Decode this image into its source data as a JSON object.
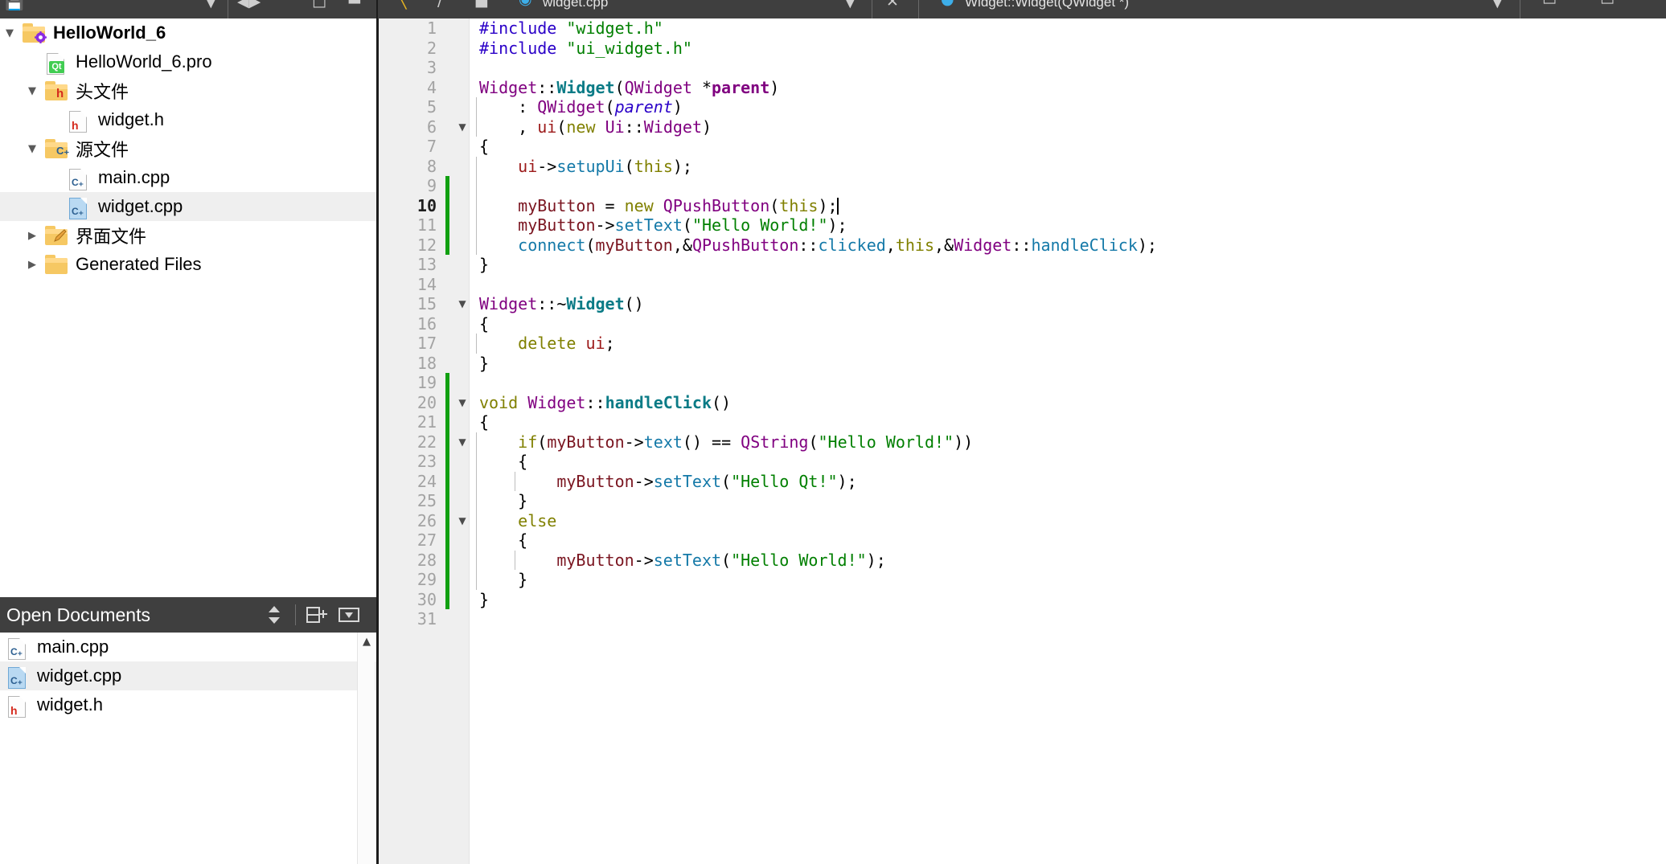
{
  "toolbar": {
    "left_glyphs": [
      "save-all-icon",
      "chevron-down-icon",
      "nav-back-forward-icon",
      "history-icon",
      "split-icon",
      "minimize-icon"
    ],
    "open_file_label": "widget.cpp",
    "symbol_label": "Widget::Widget(QWidget *)",
    "right_glyphs": [
      "chevron-down-icon",
      "close-icon",
      "location-marker-icon",
      "chevron-down-icon",
      "split-icon",
      "close-icon"
    ]
  },
  "sidebar": {
    "project_tree": [
      {
        "label": "HelloWorld_6",
        "indent": 0,
        "arrow": "open",
        "icon": "folder-project-icon",
        "bold": true,
        "selected": false
      },
      {
        "label": "HelloWorld_6.pro",
        "indent": 1,
        "arrow": "none",
        "icon": "file-qt-icon",
        "bold": false,
        "selected": false
      },
      {
        "label": "头文件",
        "indent": 1,
        "arrow": "open",
        "icon": "folder-headers-icon",
        "bold": false,
        "selected": false
      },
      {
        "label": "widget.h",
        "indent": 2,
        "arrow": "none",
        "icon": "file-h-icon",
        "bold": false,
        "selected": false
      },
      {
        "label": "源文件",
        "indent": 1,
        "arrow": "open",
        "icon": "folder-sources-icon",
        "bold": false,
        "selected": false
      },
      {
        "label": "main.cpp",
        "indent": 2,
        "arrow": "none",
        "icon": "file-cpp-icon",
        "bold": false,
        "selected": false
      },
      {
        "label": "widget.cpp",
        "indent": 2,
        "arrow": "none",
        "icon": "file-cpp-blue-icon",
        "bold": false,
        "selected": true
      },
      {
        "label": "界面文件",
        "indent": 1,
        "arrow": "closed",
        "icon": "folder-forms-icon",
        "bold": false,
        "selected": false
      },
      {
        "label": "Generated Files",
        "indent": 1,
        "arrow": "closed",
        "icon": "folder-plain-icon",
        "bold": false,
        "selected": false
      }
    ],
    "open_documents": {
      "title": "Open Documents",
      "actions": [
        "sort-toggle-icon",
        "split-add-icon",
        "dropdown-menu-icon"
      ],
      "items": [
        {
          "label": "main.cpp",
          "icon": "file-cpp-icon",
          "selected": false
        },
        {
          "label": "widget.cpp",
          "icon": "file-cpp-blue-icon",
          "selected": true
        },
        {
          "label": "widget.h",
          "icon": "file-h-icon",
          "selected": false
        }
      ]
    }
  },
  "editor": {
    "filename": "widget.cpp",
    "cursor_line": 10,
    "total_lines": 31,
    "lines": [
      {
        "n": 1,
        "fold": "",
        "changed": false,
        "indent_guides": [],
        "tokens": [
          {
            "t": "#include ",
            "c": "t-pre"
          },
          {
            "t": "\"widget.h\"",
            "c": "t-str"
          }
        ]
      },
      {
        "n": 2,
        "fold": "",
        "changed": false,
        "indent_guides": [],
        "tokens": [
          {
            "t": "#include ",
            "c": "t-pre"
          },
          {
            "t": "\"ui_widget.h\"",
            "c": "t-str"
          }
        ]
      },
      {
        "n": 3,
        "fold": "",
        "changed": false,
        "indent_guides": [],
        "tokens": []
      },
      {
        "n": 4,
        "fold": "",
        "changed": false,
        "indent_guides": [],
        "tokens": [
          {
            "t": "Widget",
            "c": "t-type"
          },
          {
            "t": "::",
            "c": "t-plain"
          },
          {
            "t": "Widget",
            "c": "t-fn"
          },
          {
            "t": "(",
            "c": "t-plain"
          },
          {
            "t": "QWidget ",
            "c": "t-type"
          },
          {
            "t": "*",
            "c": "t-plain"
          },
          {
            "t": "parent",
            "c": "t-type t-bold"
          },
          {
            "t": ")",
            "c": "t-plain"
          }
        ]
      },
      {
        "n": 5,
        "fold": "",
        "changed": false,
        "indent_guides": [
          0
        ],
        "tokens": [
          {
            "t": "    : ",
            "c": "t-plain"
          },
          {
            "t": "QWidget",
            "c": "t-type"
          },
          {
            "t": "(",
            "c": "t-plain"
          },
          {
            "t": "parent",
            "c": "t-param"
          },
          {
            "t": ")",
            "c": "t-plain"
          }
        ]
      },
      {
        "n": 6,
        "fold": "down",
        "changed": false,
        "indent_guides": [
          0
        ],
        "tokens": [
          {
            "t": "    , ",
            "c": "t-plain"
          },
          {
            "t": "ui",
            "c": "t-field"
          },
          {
            "t": "(",
            "c": "t-plain"
          },
          {
            "t": "new ",
            "c": "t-kw"
          },
          {
            "t": "Ui",
            "c": "t-type"
          },
          {
            "t": "::",
            "c": "t-plain"
          },
          {
            "t": "Widget",
            "c": "t-type"
          },
          {
            "t": ")",
            "c": "t-plain"
          }
        ]
      },
      {
        "n": 7,
        "fold": "",
        "changed": false,
        "indent_guides": [],
        "tokens": [
          {
            "t": "{",
            "c": "t-plain"
          }
        ]
      },
      {
        "n": 8,
        "fold": "",
        "changed": false,
        "indent_guides": [
          0
        ],
        "tokens": [
          {
            "t": "    ",
            "c": "t-plain"
          },
          {
            "t": "ui",
            "c": "t-field"
          },
          {
            "t": "->",
            "c": "t-plain"
          },
          {
            "t": "setupUi",
            "c": "t-call"
          },
          {
            "t": "(",
            "c": "t-plain"
          },
          {
            "t": "this",
            "c": "t-kw"
          },
          {
            "t": ");",
            "c": "t-plain"
          }
        ]
      },
      {
        "n": 9,
        "fold": "",
        "changed": true,
        "indent_guides": [
          0
        ],
        "tokens": []
      },
      {
        "n": 10,
        "fold": "",
        "changed": true,
        "indent_guides": [
          0
        ],
        "caret": true,
        "tokens": [
          {
            "t": "    ",
            "c": "t-plain"
          },
          {
            "t": "myButton",
            "c": "t-var"
          },
          {
            "t": " = ",
            "c": "t-plain"
          },
          {
            "t": "new ",
            "c": "t-kw"
          },
          {
            "t": "QPushButton",
            "c": "t-type"
          },
          {
            "t": "(",
            "c": "t-plain"
          },
          {
            "t": "this",
            "c": "t-kw"
          },
          {
            "t": ");",
            "c": "t-plain"
          }
        ]
      },
      {
        "n": 11,
        "fold": "",
        "changed": true,
        "indent_guides": [
          0
        ],
        "tokens": [
          {
            "t": "    ",
            "c": "t-plain"
          },
          {
            "t": "myButton",
            "c": "t-var"
          },
          {
            "t": "->",
            "c": "t-plain"
          },
          {
            "t": "setText",
            "c": "t-call"
          },
          {
            "t": "(",
            "c": "t-plain"
          },
          {
            "t": "\"Hello World!\"",
            "c": "t-str"
          },
          {
            "t": ");",
            "c": "t-plain"
          }
        ]
      },
      {
        "n": 12,
        "fold": "",
        "changed": true,
        "indent_guides": [
          0
        ],
        "tokens": [
          {
            "t": "    ",
            "c": "t-plain"
          },
          {
            "t": "connect",
            "c": "t-call"
          },
          {
            "t": "(",
            "c": "t-plain"
          },
          {
            "t": "myButton",
            "c": "t-var"
          },
          {
            "t": ",&",
            "c": "t-plain"
          },
          {
            "t": "QPushButton",
            "c": "t-type"
          },
          {
            "t": "::",
            "c": "t-plain"
          },
          {
            "t": "clicked",
            "c": "t-call"
          },
          {
            "t": ",",
            "c": "t-plain"
          },
          {
            "t": "this",
            "c": "t-kw"
          },
          {
            "t": ",&",
            "c": "t-plain"
          },
          {
            "t": "Widget",
            "c": "t-type"
          },
          {
            "t": "::",
            "c": "t-plain"
          },
          {
            "t": "handleClick",
            "c": "t-call"
          },
          {
            "t": ");",
            "c": "t-plain"
          }
        ]
      },
      {
        "n": 13,
        "fold": "",
        "changed": false,
        "indent_guides": [],
        "tokens": [
          {
            "t": "}",
            "c": "t-plain"
          }
        ]
      },
      {
        "n": 14,
        "fold": "",
        "changed": false,
        "indent_guides": [],
        "tokens": []
      },
      {
        "n": 15,
        "fold": "down",
        "changed": false,
        "indent_guides": [],
        "tokens": [
          {
            "t": "Widget",
            "c": "t-type"
          },
          {
            "t": "::~",
            "c": "t-plain"
          },
          {
            "t": "Widget",
            "c": "t-fn"
          },
          {
            "t": "()",
            "c": "t-plain"
          }
        ]
      },
      {
        "n": 16,
        "fold": "",
        "changed": false,
        "indent_guides": [],
        "tokens": [
          {
            "t": "{",
            "c": "t-plain"
          }
        ]
      },
      {
        "n": 17,
        "fold": "",
        "changed": false,
        "indent_guides": [
          0
        ],
        "tokens": [
          {
            "t": "    ",
            "c": "t-plain"
          },
          {
            "t": "delete ",
            "c": "t-kw"
          },
          {
            "t": "ui",
            "c": "t-field"
          },
          {
            "t": ";",
            "c": "t-plain"
          }
        ]
      },
      {
        "n": 18,
        "fold": "",
        "changed": false,
        "indent_guides": [],
        "tokens": [
          {
            "t": "}",
            "c": "t-plain"
          }
        ]
      },
      {
        "n": 19,
        "fold": "",
        "changed": true,
        "indent_guides": [],
        "tokens": []
      },
      {
        "n": 20,
        "fold": "down",
        "changed": true,
        "indent_guides": [],
        "tokens": [
          {
            "t": "void ",
            "c": "t-kw"
          },
          {
            "t": "Widget",
            "c": "t-type"
          },
          {
            "t": "::",
            "c": "t-plain"
          },
          {
            "t": "handleClick",
            "c": "t-fn"
          },
          {
            "t": "()",
            "c": "t-plain"
          }
        ]
      },
      {
        "n": 21,
        "fold": "",
        "changed": true,
        "indent_guides": [],
        "tokens": [
          {
            "t": "{",
            "c": "t-plain"
          }
        ]
      },
      {
        "n": 22,
        "fold": "down",
        "changed": true,
        "indent_guides": [
          0
        ],
        "tokens": [
          {
            "t": "    ",
            "c": "t-plain"
          },
          {
            "t": "if",
            "c": "t-kw"
          },
          {
            "t": "(",
            "c": "t-plain"
          },
          {
            "t": "myButton",
            "c": "t-var"
          },
          {
            "t": "->",
            "c": "t-plain"
          },
          {
            "t": "text",
            "c": "t-call"
          },
          {
            "t": "() ",
            "c": "t-plain"
          },
          {
            "t": "==",
            "c": "t-plain"
          },
          {
            "t": " ",
            "c": "t-plain"
          },
          {
            "t": "QString",
            "c": "t-type"
          },
          {
            "t": "(",
            "c": "t-plain"
          },
          {
            "t": "\"Hello World!\"",
            "c": "t-str"
          },
          {
            "t": "))",
            "c": "t-plain"
          }
        ]
      },
      {
        "n": 23,
        "fold": "",
        "changed": true,
        "indent_guides": [
          0
        ],
        "tokens": [
          {
            "t": "    {",
            "c": "t-plain"
          }
        ]
      },
      {
        "n": 24,
        "fold": "",
        "changed": true,
        "indent_guides": [
          0,
          1
        ],
        "tokens": [
          {
            "t": "        ",
            "c": "t-plain"
          },
          {
            "t": "myButton",
            "c": "t-var"
          },
          {
            "t": "->",
            "c": "t-plain"
          },
          {
            "t": "setText",
            "c": "t-call"
          },
          {
            "t": "(",
            "c": "t-plain"
          },
          {
            "t": "\"Hello Qt!\"",
            "c": "t-str"
          },
          {
            "t": ");",
            "c": "t-plain"
          }
        ]
      },
      {
        "n": 25,
        "fold": "",
        "changed": true,
        "indent_guides": [
          0
        ],
        "tokens": [
          {
            "t": "    }",
            "c": "t-plain"
          }
        ]
      },
      {
        "n": 26,
        "fold": "down",
        "changed": true,
        "indent_guides": [
          0
        ],
        "tokens": [
          {
            "t": "    ",
            "c": "t-plain"
          },
          {
            "t": "else",
            "c": "t-kw"
          }
        ]
      },
      {
        "n": 27,
        "fold": "",
        "changed": true,
        "indent_guides": [
          0
        ],
        "tokens": [
          {
            "t": "    {",
            "c": "t-plain"
          }
        ]
      },
      {
        "n": 28,
        "fold": "",
        "changed": true,
        "indent_guides": [
          0,
          1
        ],
        "tokens": [
          {
            "t": "        ",
            "c": "t-plain"
          },
          {
            "t": "myButton",
            "c": "t-var"
          },
          {
            "t": "->",
            "c": "t-plain"
          },
          {
            "t": "setText",
            "c": "t-call"
          },
          {
            "t": "(",
            "c": "t-plain"
          },
          {
            "t": "\"Hello World!\"",
            "c": "t-str"
          },
          {
            "t": ");",
            "c": "t-plain"
          }
        ]
      },
      {
        "n": 29,
        "fold": "",
        "changed": true,
        "indent_guides": [
          0
        ],
        "tokens": [
          {
            "t": "    }",
            "c": "t-plain"
          }
        ]
      },
      {
        "n": 30,
        "fold": "",
        "changed": true,
        "indent_guides": [],
        "tokens": [
          {
            "t": "}",
            "c": "t-plain"
          }
        ]
      },
      {
        "n": 31,
        "fold": "",
        "changed": false,
        "indent_guides": [],
        "tokens": []
      }
    ]
  },
  "colors": {
    "toolbar_bg": "#3f3f3f",
    "selection_bg": "#efefef",
    "gutter_bg": "#efefef",
    "change_bar": "#11a011",
    "string": "#007f00",
    "type": "#800080",
    "keyword": "#808000",
    "call": "#1479a8",
    "preprocessor": "#2a00c8",
    "member": "#7a1520"
  }
}
